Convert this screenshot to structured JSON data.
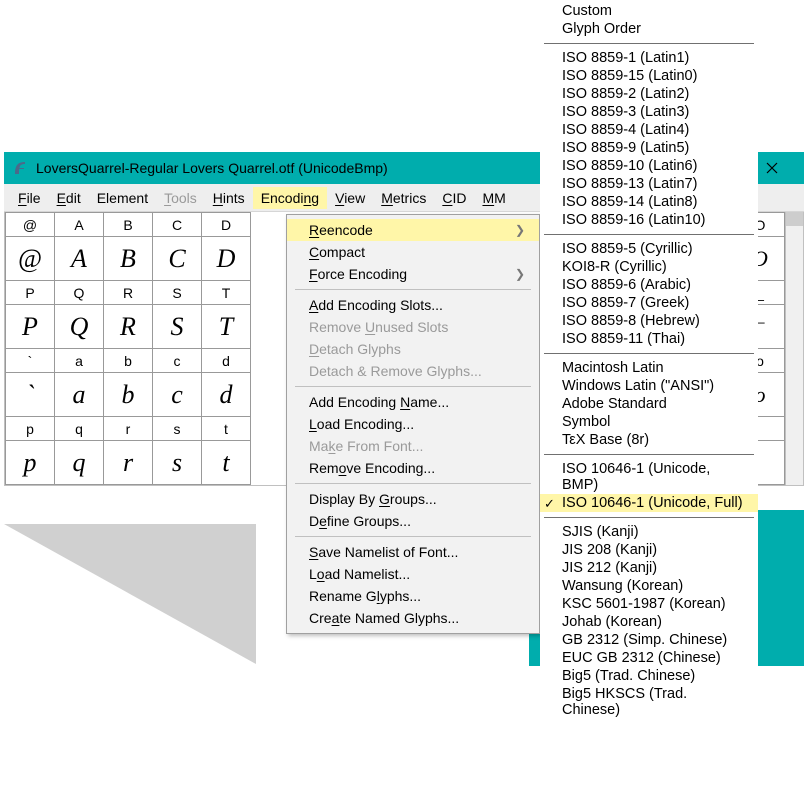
{
  "title": "LoversQuarrel-Regular  Lovers Quarrel.otf (UnicodeBmp)",
  "menubar": [
    {
      "label": "File",
      "u": "F",
      "disabled": false
    },
    {
      "label": "Edit",
      "u": "E",
      "disabled": false
    },
    {
      "label": "Element",
      "u": "E",
      "disabled": false,
      "off": 1
    },
    {
      "label": "Tools",
      "u": "T",
      "disabled": true
    },
    {
      "label": "Hints",
      "u": "H",
      "disabled": false
    },
    {
      "label": "Encoding",
      "u": "n",
      "disabled": false,
      "open": true,
      "off": 1
    },
    {
      "label": "View",
      "u": "V",
      "disabled": false
    },
    {
      "label": "Metrics",
      "u": "M",
      "disabled": false
    },
    {
      "label": "CID",
      "u": "C",
      "disabled": false
    },
    {
      "label": "MM",
      "u": "M",
      "disabled": false
    }
  ],
  "glyphs": {
    "row0": [
      "@",
      "A",
      "B",
      "C",
      "D"
    ],
    "row1": [
      "@",
      "A",
      "B",
      "C",
      "D"
    ],
    "row2": [
      "P",
      "Q",
      "R",
      "S",
      "T"
    ],
    "row3": [
      "P",
      "Q",
      "R",
      "S",
      "T"
    ],
    "row4": [
      "`",
      "a",
      "b",
      "c",
      "d"
    ],
    "row5": [
      "`",
      "a",
      "b",
      "c",
      "d"
    ],
    "row6": [
      "p",
      "q",
      "r",
      "s",
      "t"
    ],
    "row7": [
      "p",
      "q",
      "r",
      "s",
      "t"
    ],
    "row8": [
      "",
      "",
      "",
      "",
      ""
    ],
    "row9": [
      "",
      "",
      "",
      "",
      ""
    ],
    "rcol_heads": [
      "O",
      "_",
      "o"
    ],
    "rcol_empty": ""
  },
  "dropdown": [
    {
      "label": "Reencode",
      "u": "R",
      "arrow": true,
      "hl": true
    },
    {
      "label": "Compact",
      "u": "C"
    },
    {
      "label": "Force Encoding",
      "u": "F",
      "arrow": true
    },
    {
      "sep": true
    },
    {
      "label": "Add Encoding Slots...",
      "u": "A"
    },
    {
      "label": "Remove Unused Slots",
      "u": "U",
      "disabled": true
    },
    {
      "label": "Detach Glyphs",
      "u": "D",
      "disabled": true
    },
    {
      "label": "Detach & Remove Glyphs...",
      "disabled": true
    },
    {
      "sep": true
    },
    {
      "label": "Add Encoding Name...",
      "u": "N"
    },
    {
      "label": "Load Encoding...",
      "u": "L"
    },
    {
      "label": "Make From Font...",
      "u": "k",
      "disabled": true
    },
    {
      "label": "Remove Encoding...",
      "u": "o"
    },
    {
      "sep": true
    },
    {
      "label": "Display By Groups...",
      "u": "G"
    },
    {
      "label": "Define Groups...",
      "u": "e"
    },
    {
      "sep": true
    },
    {
      "label": "Save Namelist of Font...",
      "u": "S"
    },
    {
      "label": "Load Namelist...",
      "u": "o"
    },
    {
      "label": "Rename Glyphs...",
      "u": "l"
    },
    {
      "label": "Create Named Glyphs...",
      "u": "a"
    }
  ],
  "submenu": [
    {
      "label": "Custom"
    },
    {
      "label": "Glyph Order"
    },
    {
      "sep": true
    },
    {
      "label": "ISO 8859-1  (Latin1)"
    },
    {
      "label": "ISO 8859-15  (Latin0)"
    },
    {
      "label": "ISO 8859-2  (Latin2)"
    },
    {
      "label": "ISO 8859-3  (Latin3)"
    },
    {
      "label": "ISO 8859-4  (Latin4)"
    },
    {
      "label": "ISO 8859-9  (Latin5)"
    },
    {
      "label": "ISO 8859-10  (Latin6)"
    },
    {
      "label": "ISO 8859-13  (Latin7)"
    },
    {
      "label": "ISO 8859-14  (Latin8)"
    },
    {
      "label": "ISO 8859-16  (Latin10)"
    },
    {
      "sep": true
    },
    {
      "label": "ISO 8859-5 (Cyrillic)"
    },
    {
      "label": "KOI8-R (Cyrillic)"
    },
    {
      "label": "ISO 8859-6 (Arabic)"
    },
    {
      "label": "ISO 8859-7 (Greek)"
    },
    {
      "label": "ISO 8859-8 (Hebrew)"
    },
    {
      "label": "ISO 8859-11 (Thai)"
    },
    {
      "sep": true
    },
    {
      "label": "Macintosh Latin"
    },
    {
      "label": "Windows Latin (\"ANSI\")"
    },
    {
      "label": "Adobe Standard"
    },
    {
      "label": "Symbol"
    },
    {
      "label": "ΤεΧ Base (8r)"
    },
    {
      "sep": true
    },
    {
      "label": "ISO 10646-1 (Unicode, BMP)"
    },
    {
      "label": "ISO 10646-1 (Unicode, Full)",
      "hl": true,
      "check": true
    },
    {
      "sep": true
    },
    {
      "label": "SJIS (Kanji)"
    },
    {
      "label": "JIS 208 (Kanji)"
    },
    {
      "label": "JIS 212 (Kanji)"
    },
    {
      "label": "Wansung (Korean)"
    },
    {
      "label": "KSC 5601-1987 (Korean)"
    },
    {
      "label": "Johab (Korean)"
    },
    {
      "label": "GB 2312 (Simp. Chinese)"
    },
    {
      "label": "EUC GB 2312 (Chinese)"
    },
    {
      "label": "Big5 (Trad. Chinese)"
    },
    {
      "label": "Big5 HKSCS (Trad. Chinese)"
    }
  ]
}
